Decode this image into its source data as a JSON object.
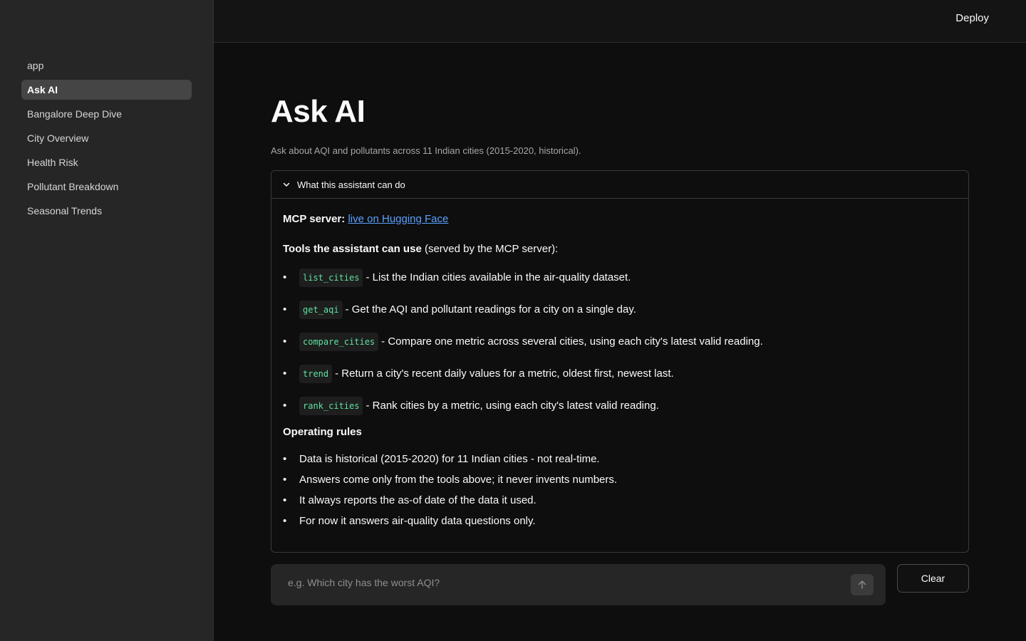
{
  "header": {
    "deploy_label": "Deploy"
  },
  "sidebar": {
    "items": [
      {
        "label": "app"
      },
      {
        "label": "Ask AI",
        "active": true
      },
      {
        "label": "Bangalore Deep Dive"
      },
      {
        "label": "City Overview"
      },
      {
        "label": "Health Risk"
      },
      {
        "label": "Pollutant Breakdown"
      },
      {
        "label": "Seasonal Trends"
      }
    ]
  },
  "main": {
    "title": "Ask AI",
    "subtitle": "Ask about AQI and pollutants across 11 Indian cities (2015-2020, historical).",
    "expander": {
      "label": "What this assistant can do",
      "expanded": true,
      "mcp_label": "MCP server:",
      "mcp_link": "live on Hugging Face",
      "tools_heading": "Tools the assistant can use",
      "tools_heading_suffix": " (served by the MCP server):",
      "tools": [
        {
          "name": "list_cities",
          "desc": "- List the Indian cities available in the air-quality dataset."
        },
        {
          "name": "get_aqi",
          "desc": "- Get the AQI and pollutant readings for a city on a single day."
        },
        {
          "name": "compare_cities",
          "desc": "- Compare one metric across several cities, using each city's latest valid reading."
        },
        {
          "name": "trend",
          "desc": "- Return a city's recent daily values for a metric, oldest first, newest last."
        },
        {
          "name": "rank_cities",
          "desc": "- Rank cities by a metric, using each city's latest valid reading."
        }
      ],
      "rules_heading": "Operating rules",
      "rules": [
        "Data is historical (2015-2020) for 11 Indian cities - not real-time.",
        "Answers come only from the tools above; it never invents numbers.",
        "It always reports the as-of date of the data it used.",
        "For now it answers air-quality data questions only."
      ]
    }
  },
  "chat": {
    "placeholder": "e.g. Which city has the worst AQI?",
    "value": "",
    "clear_label": "Clear"
  },
  "colors": {
    "accent_link": "#5aa1ff",
    "code_text": "#5ee3a0",
    "background": "#0e0e0e",
    "sidebar": "#262626"
  }
}
